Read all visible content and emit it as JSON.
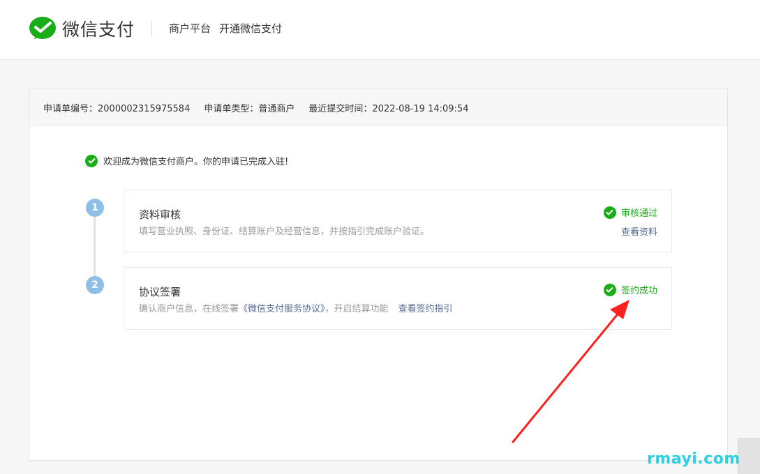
{
  "header": {
    "brand_name": "微信支付",
    "nav": [
      "商户平台",
      "开通微信支付"
    ]
  },
  "application": {
    "number_label": "申请单编号：",
    "number_value": "2000002315975584",
    "type_label": "申请单类型：",
    "type_value": "普通商户",
    "submit_label": "最近提交时间：",
    "submit_value": "2022-08-19 14:09:54"
  },
  "welcome_message": "欢迎成为微信支付商户。你的申请已完成入驻!",
  "steps": [
    {
      "number": "1",
      "title": "资料审核",
      "description": "填写营业执照、身份证、结算账户及经营信息，并按指引完成账户验证。",
      "status": "审核通过",
      "link": "查看资料"
    },
    {
      "number": "2",
      "title": "协议签署",
      "description_prefix": "确认商户信息，在线签署",
      "agreement": "《微信支付服务协议》",
      "description_suffix": "，开启结算功能",
      "link": "查看签约指引",
      "status": "签约成功"
    }
  ],
  "watermark": "rmayi.com",
  "colors": {
    "brand_green": "#1aad19",
    "link_blue": "#576b95",
    "step_blue": "#8fbfe6",
    "annotation_red": "#ff2020",
    "watermark_cyan": "#2bd1e3"
  }
}
